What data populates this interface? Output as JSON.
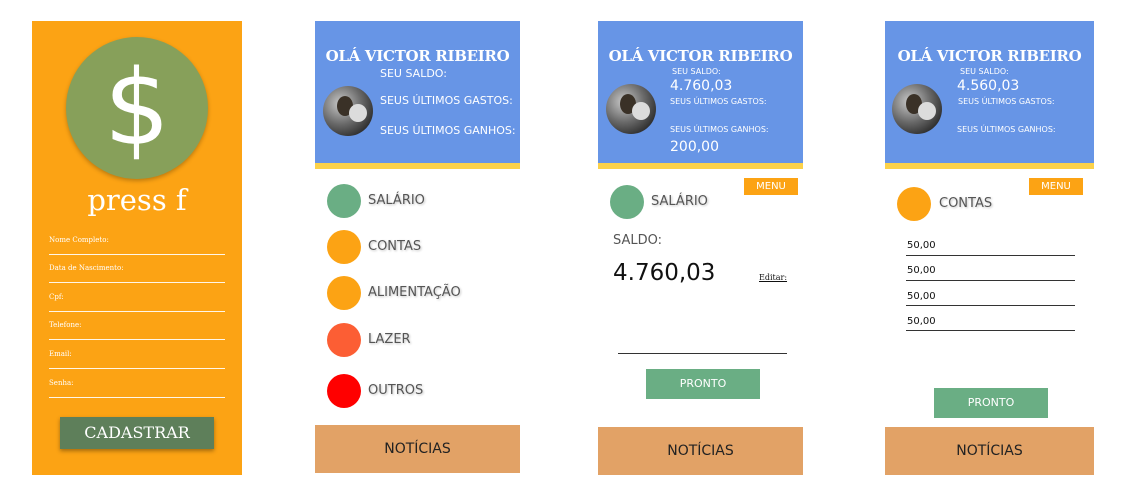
{
  "signup": {
    "logo_symbol": "$",
    "app_name": "press f",
    "fields": [
      "Nome Completo:",
      "Data de Nascimento:",
      "Cpf:",
      "Telefone:",
      "Email:",
      "Senha:"
    ],
    "submit_label": "CADASTRAR",
    "bg_color": "#fca314",
    "logo_color": "#87a05a",
    "button_color": "#5e7f5a"
  },
  "home": {
    "greeting": "OLÁ VICTOR RIBEIRO",
    "saldo_label": "SEU SALDO:",
    "gastos_label": "SEUS ÚLTIMOS GASTOS:",
    "ganhos_label": "SEUS ÚLTIMOS GANHOS:",
    "categories": [
      {
        "label": "SALÁRIO",
        "color": "#6aae84"
      },
      {
        "label": "CONTAS",
        "color": "#fca314"
      },
      {
        "label": "ALIMENTAÇÃO",
        "color": "#fca314"
      },
      {
        "label": "LAZER",
        "color": "#fc5e34"
      },
      {
        "label": "OUTROS",
        "color": "#ff0000"
      }
    ],
    "news_label": "NOTÍCIAS",
    "header_color": "#6795e6",
    "accent_bar_color": "#fcd24a",
    "news_color": "#e2a266"
  },
  "salario": {
    "greeting": "OLÁ VICTOR RIBEIRO",
    "saldo_label": "SEU SALDO:",
    "saldo_value": "4.760,03",
    "gastos_label": "SEUS ÚLTIMOS GASTOS:",
    "ganhos_label": "SEUS ÚLTIMOS GANHOS:",
    "ganhos_value": "200,00",
    "menu_label": "MENU",
    "category_label": "SALÁRIO",
    "body_saldo_label": "SALDO:",
    "body_saldo_value": "4.760,03",
    "edit_label": "Editar:",
    "pronto_label": "PRONTO",
    "news_label": "NOTÍCIAS"
  },
  "contas": {
    "greeting": "OLÁ VICTOR RIBEIRO",
    "saldo_label": "SEU SALDO:",
    "saldo_value": "4.560,03",
    "gastos_label": "SEUS ÚLTIMOS GASTOS:",
    "ganhos_label": "SEUS ÚLTIMOS GANHOS:",
    "menu_label": "MENU",
    "category_label": "CONTAS",
    "entries": [
      "50,00",
      "50,00",
      "50,00",
      "50,00"
    ],
    "pronto_label": "PRONTO",
    "news_label": "NOTÍCIAS"
  }
}
